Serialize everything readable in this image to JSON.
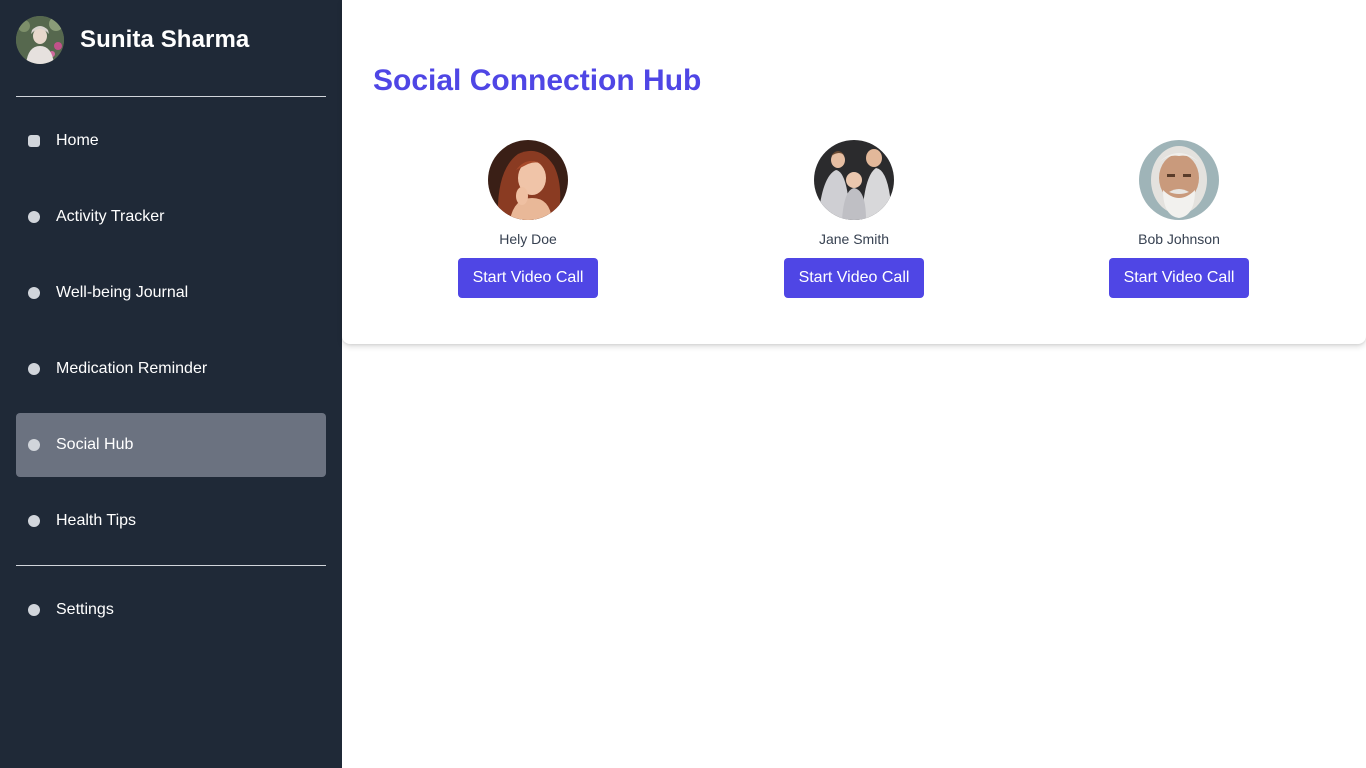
{
  "profile": {
    "name": "Sunita Sharma",
    "avatar_icon": "user-avatar"
  },
  "nav": [
    {
      "label": "Home",
      "icon": "dot-icon"
    },
    {
      "label": "Activity Tracker",
      "icon": "dot-icon"
    },
    {
      "label": "Well-being Journal",
      "icon": "dot-icon"
    },
    {
      "label": "Medication Reminder",
      "icon": "dot-icon"
    },
    {
      "label": "Social Hub",
      "icon": "dot-icon",
      "active": true
    },
    {
      "label": "Health Tips",
      "icon": "dot-icon"
    }
  ],
  "nav_bottom": [
    {
      "label": "Settings",
      "icon": "dot-icon"
    }
  ],
  "main": {
    "title": "Social Connection Hub",
    "contacts": [
      {
        "name": "Hely Doe",
        "button": "Start Video Call"
      },
      {
        "name": "Jane Smith",
        "button": "Start Video Call"
      },
      {
        "name": "Bob Johnson",
        "button": "Start Video Call"
      }
    ]
  },
  "colors": {
    "sidebar_bg": "#1f2937",
    "active_item_bg": "#6b7280",
    "accent": "#4f46e5",
    "title_color": "#4f46e5"
  }
}
